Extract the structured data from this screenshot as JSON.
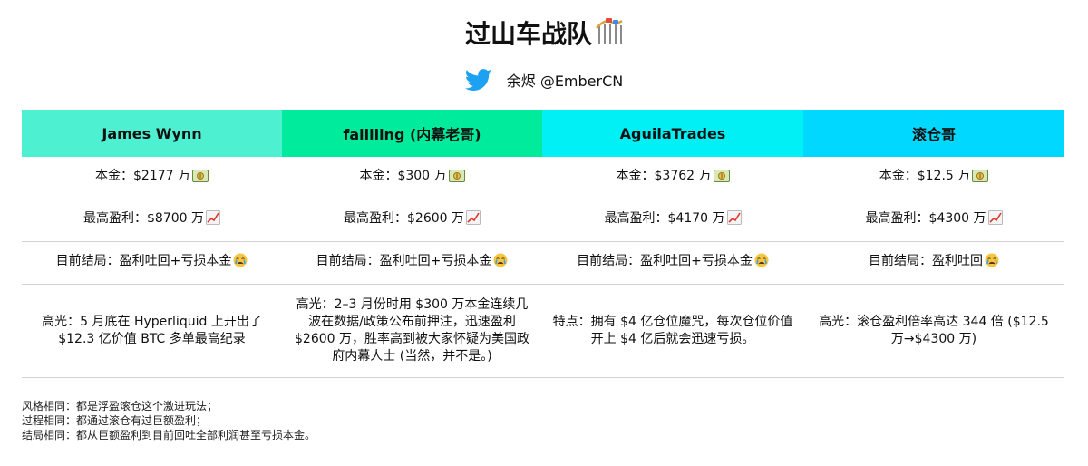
{
  "title": "过山车战队",
  "author": {
    "handle": "余烬 @EmberCN"
  },
  "colors": {
    "col1": "#4ef0d2",
    "col2": "#00ec9c",
    "col3": "#00f0f6",
    "col4": "#00d8ff",
    "border": "#d2d2d2"
  },
  "columns": [
    {
      "name": "James Wynn",
      "principal": "本金：$2177 万",
      "max_profit": "最高盈利：$8700 万",
      "outcome": "目前结局：盈利吐回+亏损本金",
      "note": "高光：5 月底在 Hyperliquid 上开出了 $12.3 亿价值 BTC 多单最高纪录"
    },
    {
      "name": "falllling (内幕老哥)",
      "principal": "本金：$300 万",
      "max_profit": "最高盈利：$2600 万",
      "outcome": "目前结局：盈利吐回+亏损本金",
      "note": "高光：2–3 月份时用 $300 万本金连续几波在数据/政策公布前押注，迅速盈利 $2600 万，胜率高到被大家怀疑为美国政府内幕人士 (当然，并不是。)"
    },
    {
      "name": "AguilaTrades",
      "principal": "本金：$3762 万",
      "max_profit": "最高盈利：$4170 万",
      "outcome": "目前结局：盈利吐回+亏损本金",
      "note": "特点：拥有 $4 亿仓位魔咒，每次仓位价值开上 $4 亿后就会迅速亏损。"
    },
    {
      "name": "滚仓哥",
      "principal": "本金：$12.5 万",
      "max_profit": "最高盈利：$4300 万",
      "outcome": "目前结局：盈利吐回",
      "note": "高光：滚仓盈利倍率高达 344 倍 ($12.5 万→$4300 万)"
    }
  ],
  "notes": [
    "风格相同：都是浮盈滚仓这个激进玩法；",
    "过程相同：都通过滚仓有过巨额盈利；",
    "结局相同：都从巨额盈利到目前回吐全部利润甚至亏损本金。"
  ]
}
